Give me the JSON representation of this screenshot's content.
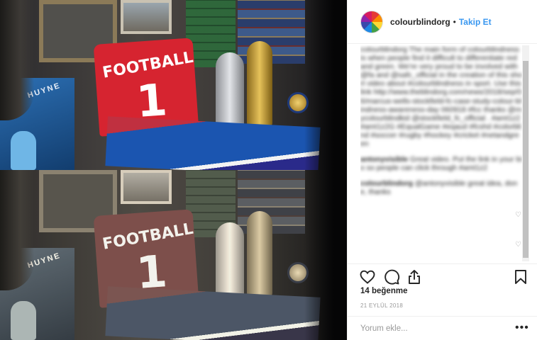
{
  "post": {
    "image_alt": "",
    "image": {
      "poster_text": "HUYNE",
      "jersey_text": "FOOTBALL",
      "jersey_number": "1"
    }
  },
  "header": {
    "username": "colourblindorg",
    "separator": "•",
    "follow_label": "Takip Et"
  },
  "caption": {
    "text": "colourblindorg The main form of colourblindness is when people find it difficult to differentiate red and green. We're very proud to be involved with @fa and @safc_official in the creation of this short video about #colourblindness in sport. Use this link http://www.theblindorg.com/news/2018/sep/06/marcus-wells-stockfield-fc-case-study-colour-blindness-awareness-day 060918 #fcc thanks @mycolourblindkid @stockfield_fc_official . #amt1z2 #amt1z2G #EqualGame #eqaud #fcshd #colorblind #soccer #rugby #hockey #cricket #netandgreen"
  },
  "comments": [
    {
      "user": "antonyvisible",
      "text": "Great video. Put the link in your bio so people can click through #amt1z2"
    },
    {
      "user": "colourblindorg",
      "text": "@antonyvisible great idea, done, thanks"
    }
  ],
  "actions": {
    "like_icon": "heart-icon",
    "comment_icon": "comment-icon",
    "share_icon": "share-icon",
    "save_icon": "bookmark-icon"
  },
  "likes_text": "14 beğenme",
  "date_text": "21 EYLÜL 2018",
  "add_comment": {
    "placeholder": "Yorum ekle...",
    "more_label": "•••"
  }
}
